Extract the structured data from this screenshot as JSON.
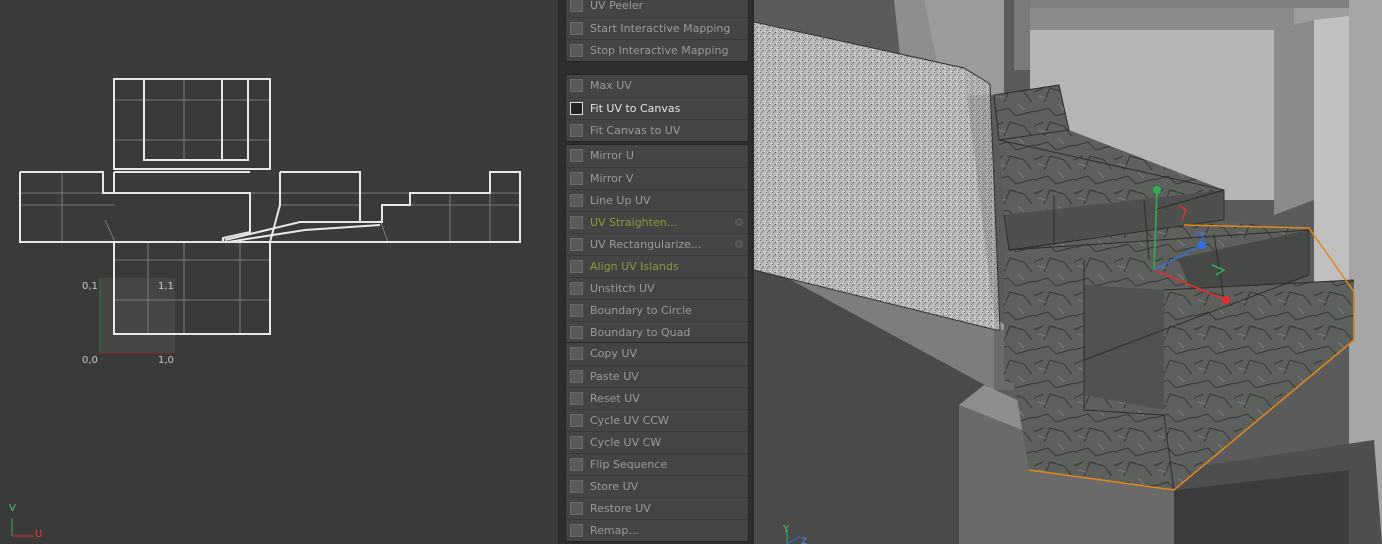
{
  "uv_editor": {
    "coords": {
      "c01": "0,1",
      "c11": "1,1",
      "c00": "0,0",
      "c10": "1,0"
    },
    "axis": {
      "v": "V",
      "u": "U"
    }
  },
  "menu": {
    "groups": [
      [
        {
          "label": "UV Peeler",
          "icon": "uv-peeler-icon"
        },
        {
          "label": "Start Interactive Mapping",
          "icon": "start-mapping-icon"
        },
        {
          "label": "Stop Interactive Mapping",
          "icon": "stop-mapping-icon"
        }
      ],
      [
        {
          "label": "Max UV",
          "icon": "max-uv-icon"
        },
        {
          "label": "Fit UV to Canvas",
          "icon": "fit-uv-icon",
          "state": "active"
        },
        {
          "label": "Fit Canvas to UV",
          "icon": "fit-canvas-icon"
        }
      ],
      [
        {
          "label": "Mirror U",
          "icon": "mirror-u-icon"
        },
        {
          "label": "Mirror V",
          "icon": "mirror-v-icon"
        },
        {
          "label": "Line Up UV",
          "icon": "line-up-icon"
        },
        {
          "label": "UV Straighten...",
          "icon": "straighten-icon",
          "state": "green",
          "gear": true
        },
        {
          "label": "UV Rectangularize...",
          "icon": "rectangularize-icon",
          "gear": true
        },
        {
          "label": "Align UV Islands",
          "icon": "align-islands-icon",
          "state": "green"
        },
        {
          "label": "Unstitch UV",
          "icon": "unstitch-icon"
        },
        {
          "label": "Boundary to Circle",
          "icon": "boundary-circle-icon"
        },
        {
          "label": "Boundary to Quad",
          "icon": "boundary-quad-icon"
        }
      ],
      [
        {
          "label": "Copy UV",
          "icon": "copy-uv-icon"
        },
        {
          "label": "Paste UV",
          "icon": "paste-uv-icon"
        },
        {
          "label": "Reset UV",
          "icon": "reset-uv-icon"
        },
        {
          "label": "Cycle UV CCW",
          "icon": "cycle-ccw-icon"
        },
        {
          "label": "Cycle UV CW",
          "icon": "cycle-cw-icon"
        },
        {
          "label": "Flip Sequence",
          "icon": "flip-sequence-icon"
        },
        {
          "label": "Store UV",
          "icon": "store-uv-icon"
        },
        {
          "label": "Restore UV",
          "icon": "restore-uv-icon"
        },
        {
          "label": "Remap...",
          "icon": "remap-icon"
        }
      ]
    ]
  },
  "viewport": {
    "axis": {
      "y": "Y",
      "z": "Z"
    }
  },
  "colors": {
    "green_text": "#8c9a3c",
    "selection_orange": "#e0881c",
    "axis_red": "#e03030",
    "axis_green": "#30b050",
    "axis_blue": "#3070e0"
  }
}
